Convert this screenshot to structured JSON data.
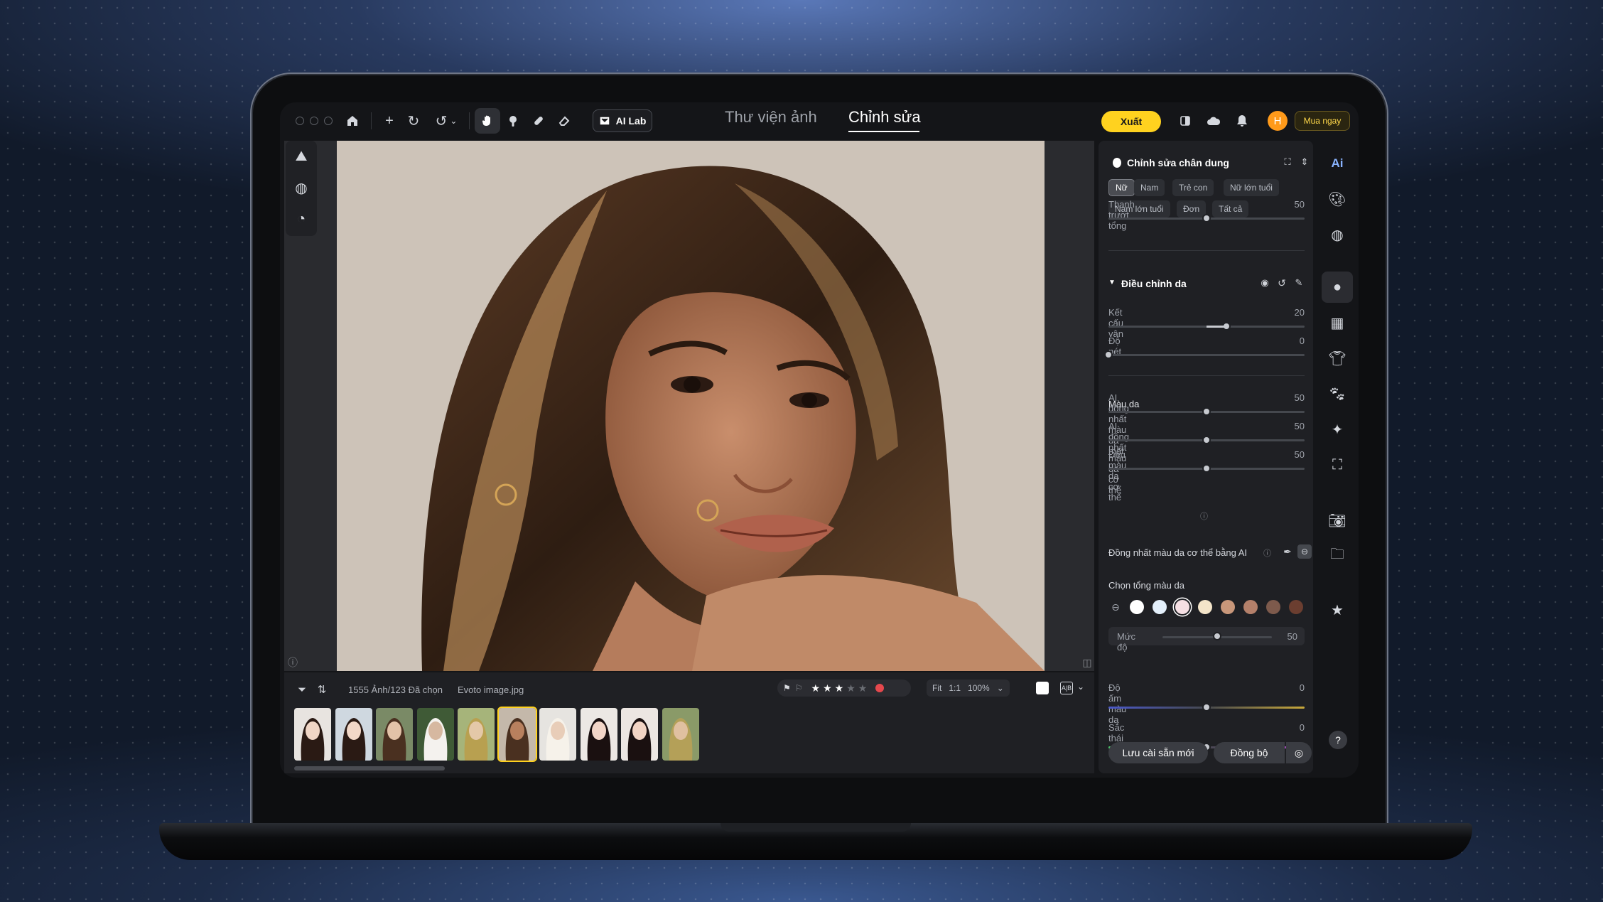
{
  "toolbar": {
    "ai_lab_label": "AI Lab",
    "tabs": [
      {
        "label": "Thư viện ảnh"
      },
      {
        "label": "Chỉnh sửa"
      }
    ],
    "export_label": "Xuất",
    "avatar_initial": "H",
    "buy_label": "Mua ngay"
  },
  "panel": {
    "portrait_title": "Chỉnh sửa chân dung",
    "chips": [
      "Nữ",
      "Nam",
      "Trẻ con",
      "Nữ lớn tuổi",
      "Nam lớn tuổi",
      "Đơn",
      "Tất cả"
    ],
    "master_slider": {
      "label": "Thanh trượt tổng",
      "value": 50
    },
    "skin_section_title": "Điều chỉnh da",
    "texture": {
      "label": "Kết cấu vân",
      "value": 20
    },
    "sharpness": {
      "label": "Độ nét",
      "value": 0
    },
    "skin_color_title": "Màu da",
    "face_unify": {
      "label": "AI đồng nhất màu da mặt",
      "value": 50
    },
    "body_unify": {
      "label": "AI đồng nhất màu da cơ thể",
      "value": 50
    },
    "body_even": {
      "label": "Đều màu da cơ thể",
      "value": 50
    },
    "ai_body_unify_label": "Đồng nhất màu da cơ thể bằng AI",
    "tone_label": "Chọn tổng màu da",
    "swatches": [
      "#ffffff",
      "#e4f0fb",
      "#f6e0e4",
      "#f3e4c9",
      "#c8977a",
      "#b4806a",
      "#7d5a4c",
      "#6b3e30"
    ],
    "level": {
      "label": "Mức độ",
      "value": 50
    },
    "warmth": {
      "label": "Độ ấm màu da",
      "value": 0
    },
    "tint": {
      "label": "Sắc thái màu",
      "value": 0
    },
    "save_preset": "Lưu cài sẵn mới",
    "sync": "Đồng bộ"
  },
  "filmstrip": {
    "count_label": "1555 Ảnh/123 Đã chọn",
    "filename": "Evoto image.jpg",
    "rating": 3,
    "fit_label": "Fit",
    "one_to_one": "1:1",
    "zoom_label": "100%",
    "selected_index": 5
  },
  "help_label": "?",
  "colors": {
    "accent": "#ffd21f",
    "avatar": "#ff9a1a",
    "flag_red": "#e5484d"
  }
}
